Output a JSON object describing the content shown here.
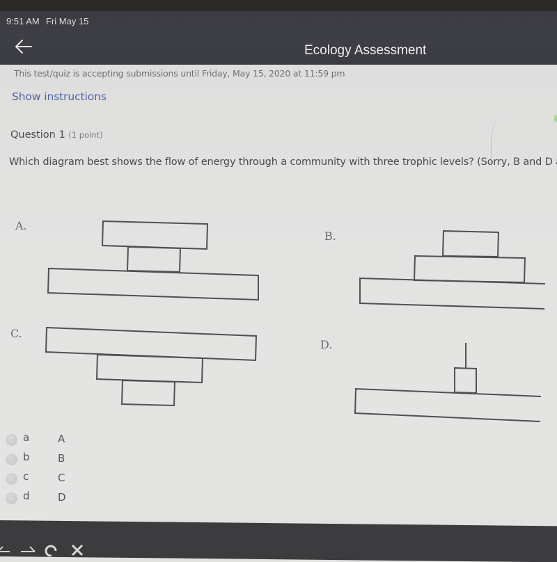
{
  "status_bar": {
    "time": "9:51 AM",
    "date": "Fri May 15"
  },
  "header": {
    "back_icon": "arrow-left-icon",
    "title": "Ecology Assessment"
  },
  "notice": "This test/quiz is accepting submissions until Friday, May 15, 2020 at 11:59 pm",
  "show_instructions_label": "Show instructions",
  "question": {
    "title": "Question 1",
    "points": "(1 point)",
    "text": "Which diagram best shows the flow of energy through a community with three trophic levels? (Sorry, B and D are cu"
  },
  "diagrams": [
    {
      "label": "A.",
      "description": "medium top, small middle, large bottom"
    },
    {
      "label": "B.",
      "description": "pyramid: small top, medium middle, large bottom"
    },
    {
      "label": "C.",
      "description": "inverted pyramid: large top, medium middle, small bottom"
    },
    {
      "label": "D.",
      "description": "line top, small middle, large bottom"
    }
  ],
  "options": [
    {
      "letter": "a",
      "text": "A",
      "selected": false
    },
    {
      "letter": "b",
      "text": "B",
      "selected": false
    },
    {
      "letter": "c",
      "text": "C",
      "selected": false
    },
    {
      "letter": "d",
      "text": "D",
      "selected": false
    }
  ],
  "browser_nav": {
    "back_icon": "arrow-left-icon",
    "forward_icon": "arrow-right-icon",
    "reload_icon": "reload-icon",
    "close_icon": "close-icon"
  }
}
